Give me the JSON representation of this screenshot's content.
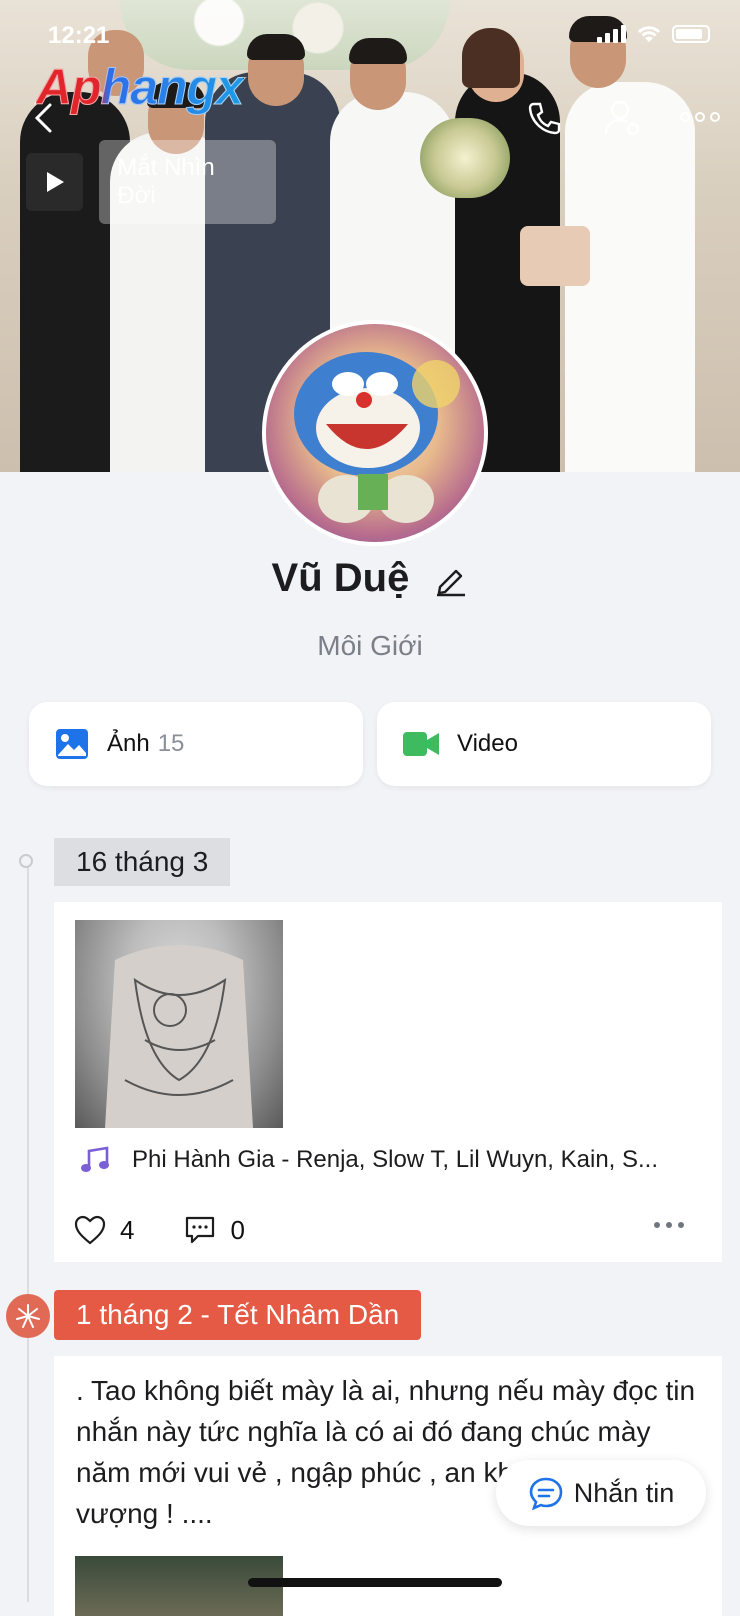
{
  "status_bar": {
    "time": "12:21"
  },
  "watermark": "Aphangx",
  "music": {
    "label": "Mắt Nhìn Đời"
  },
  "profile": {
    "name": "Vũ Duệ",
    "subtitle": "Môi Giới"
  },
  "media_buttons": {
    "photos_label": "Ảnh",
    "photos_count": "15",
    "video_label": "Video"
  },
  "timeline": [
    {
      "date": "16 tháng 3",
      "song": "Phi Hành Gia - Renja, Slow T, Lil Wuyn, Kain, S...",
      "likes": "4",
      "comments": "0"
    },
    {
      "date": "1 tháng 2 - Tết Nhâm Dần",
      "text": ". Tao không biết mày là ai, nhưng nếu mày đọc tin nhắn này tức nghĩa là có ai đó đang chúc mày năm mới vui vẻ , ngập phúc , an khang thịnh vượng ! ...."
    }
  ],
  "chat_button": {
    "label": "Nhắn tin"
  },
  "colors": {
    "accent_blue": "#1f73e8",
    "video_green": "#3dbb5e",
    "festive_red": "#e55a45"
  }
}
